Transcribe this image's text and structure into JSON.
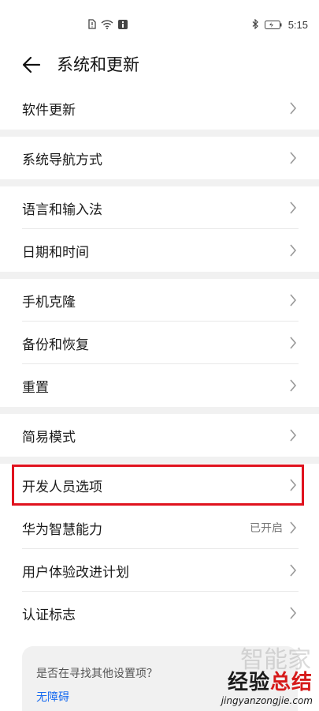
{
  "status_bar": {
    "time": "5:15",
    "left_icons": [
      "sim-alert-icon",
      "wifi-icon",
      "info-icon"
    ],
    "right_icons": [
      "bluetooth-icon",
      "battery-icon"
    ]
  },
  "header": {
    "title": "系统和更新",
    "back_icon": "arrow-left-icon"
  },
  "groups": [
    {
      "items": [
        {
          "label": "软件更新"
        }
      ]
    },
    {
      "items": [
        {
          "label": "系统导航方式"
        }
      ]
    },
    {
      "items": [
        {
          "label": "语言和输入法"
        },
        {
          "label": "日期和时间"
        }
      ]
    },
    {
      "items": [
        {
          "label": "手机克隆"
        },
        {
          "label": "备份和恢复"
        },
        {
          "label": "重置"
        }
      ]
    },
    {
      "items": [
        {
          "label": "简易模式"
        }
      ]
    },
    {
      "items": [
        {
          "label": "开发人员选项",
          "highlighted": true
        },
        {
          "label": "华为智慧能力",
          "value": "已开启"
        },
        {
          "label": "用户体验改进计划"
        },
        {
          "label": "认证标志"
        }
      ]
    }
  ],
  "suggestion": {
    "question": "是否在寻找其他设置项？",
    "link": "无障碍"
  },
  "watermark": {
    "cn_a": "经验",
    "cn_b": "总结",
    "url": "jingyanzongjie.com",
    "faded": "智能家"
  },
  "colors": {
    "highlight": "#e0121e",
    "link": "#1a6cf0",
    "gap": "#f1f1f1"
  }
}
